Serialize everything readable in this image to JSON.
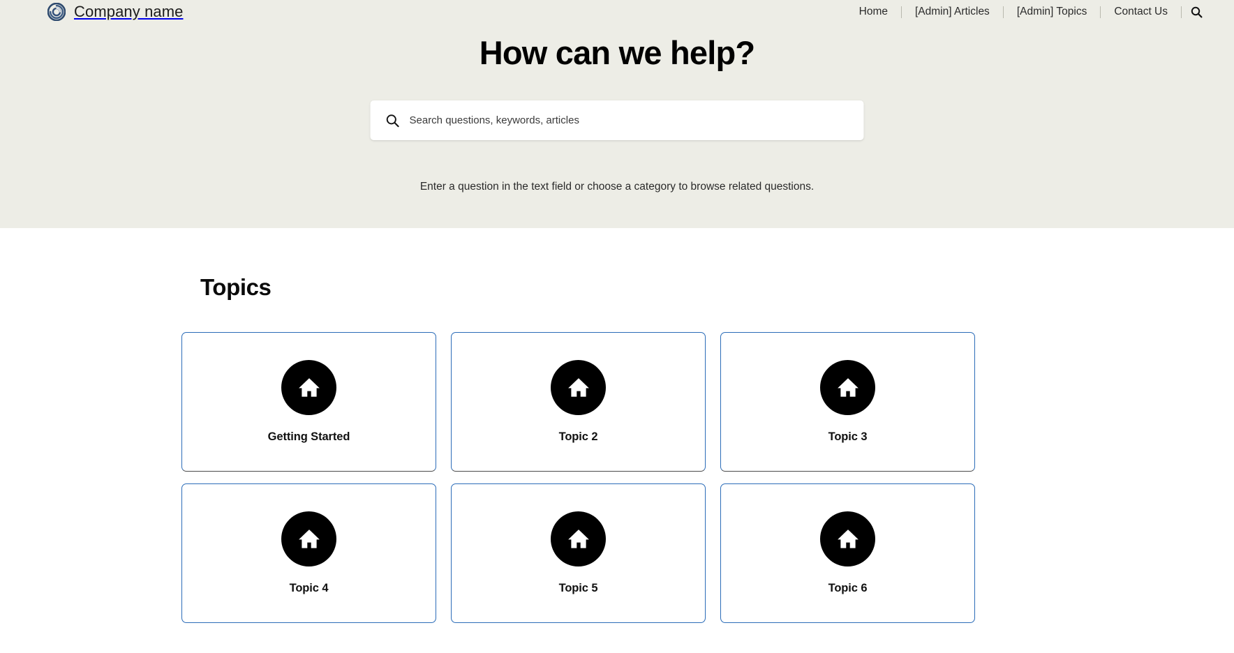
{
  "meta": {
    "hero_bg": "#EDEDE6",
    "card_border": "#2b6cb8",
    "card_border_bottom": "#4a4a4a",
    "icon_bg": "#000000",
    "logo_color": "#2e4a6e"
  },
  "navbar": {
    "brand_name": "Company name",
    "logo_icon": "spiral-logo-icon",
    "links": [
      {
        "label": "Home",
        "name": "nav-link-home"
      },
      {
        "label": "[Admin] Articles",
        "name": "nav-link-admin-articles"
      },
      {
        "label": "[Admin] Topics",
        "name": "nav-link-admin-topics"
      },
      {
        "label": "Contact Us",
        "name": "nav-link-contact-us"
      }
    ],
    "search_icon": "search-icon"
  },
  "hero": {
    "title": "How can we help?",
    "search": {
      "icon": "search-icon",
      "placeholder": "Search questions, keywords, articles",
      "value": ""
    },
    "subtitle": "Enter a question in the text field or choose a category to browse related questions."
  },
  "topics": {
    "heading": "Topics",
    "cards": [
      {
        "label": "Getting Started",
        "icon": "home-icon"
      },
      {
        "label": "Topic 2",
        "icon": "home-icon"
      },
      {
        "label": "Topic 3",
        "icon": "home-icon"
      },
      {
        "label": "Topic 4",
        "icon": "home-icon"
      },
      {
        "label": "Topic 5",
        "icon": "home-icon"
      },
      {
        "label": "Topic 6",
        "icon": "home-icon"
      }
    ]
  }
}
